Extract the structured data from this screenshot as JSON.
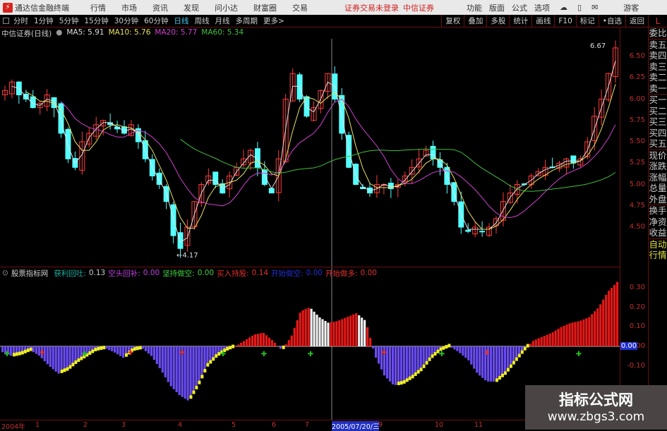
{
  "menubar": {
    "app_title": "通达信金融终端",
    "items": [
      "行情",
      "市场",
      "资讯",
      "发现",
      "问小达",
      "财富圈",
      "交易"
    ],
    "login_status": "证券交易未登录",
    "broker": "中信证券",
    "right_items": [
      "功能",
      "版面",
      "公式",
      "选项"
    ],
    "user": "游客"
  },
  "toolbar": {
    "periods": [
      "分时",
      "1分钟",
      "5分钟",
      "15分钟",
      "30分钟",
      "60分钟",
      "日线",
      "周线",
      "月线",
      "多周期",
      "更多>"
    ],
    "active": "日线",
    "right_buttons": [
      "复权",
      "叠加",
      "多股",
      "统计",
      "画线",
      "F10",
      "标记",
      "•自选",
      "返回"
    ]
  },
  "info": {
    "stock": "中信证券(日线)",
    "ma": [
      {
        "label": "MA5: 5.91",
        "color": "#dddddd"
      },
      {
        "label": "MA10: 5.76",
        "color": "#e8e060"
      },
      {
        "label": "MA20: 5.77",
        "color": "#d040d0"
      },
      {
        "label": "MA60: 5.34",
        "color": "#40c040"
      }
    ]
  },
  "price_axis": [
    "6.50",
    "6.25",
    "6.00",
    "5.75",
    "5.50",
    "5.25",
    "5.00",
    "4.75",
    "4.50"
  ],
  "annotations": {
    "high": "6.67",
    "low": "4.17"
  },
  "indicator": {
    "name": "股票指标网",
    "items": [
      {
        "label": "获利回吐:",
        "value": "0.13",
        "color": "#20b0a0"
      },
      {
        "label": "空头回补:",
        "value": "0.00",
        "color": "#c040e0"
      },
      {
        "label": "坚持做空:",
        "value": "0.00",
        "color": "#40d040"
      },
      {
        "label": "买入持股:",
        "value": "0.14",
        "color": "#e03030"
      },
      {
        "label": "开始做空:",
        "value": "0.00",
        "color": "#2030d0"
      },
      {
        "label": "开始做多:",
        "value": "0.00",
        "color": "#e03030"
      }
    ],
    "axis": [
      "0.30",
      "0.20",
      "0.10",
      "0.00",
      "-0.10"
    ],
    "current": "0.00"
  },
  "xaxis": {
    "labels": [
      "2004年",
      "1",
      "2",
      "3",
      "4",
      "5",
      "6",
      "7",
      "2005/07/20/三",
      "9",
      "10",
      "11"
    ]
  },
  "side_panel": {
    "top": "L",
    "items": [
      "委比",
      "卖五",
      "卖四",
      "卖三",
      "卖二",
      "卖一",
      "买一",
      "买二",
      "买三",
      "买四",
      "买五",
      "现价",
      "涨跌",
      "涨幅",
      "总量",
      "外盘",
      "换手",
      "净资",
      "收益",
      "自动",
      "行情"
    ]
  },
  "watermark": {
    "title": "指标公式网",
    "url": "www.zbgs3.com"
  },
  "chart_data": {
    "type": "candlestick",
    "closes": [
      6.1,
      6.2,
      6.05,
      6.0,
      5.9,
      5.95,
      6.05,
      5.9,
      5.6,
      5.3,
      5.2,
      5.5,
      5.6,
      5.7,
      5.75,
      5.7,
      5.65,
      5.6,
      5.7,
      5.5,
      5.3,
      5.1,
      5.0,
      4.8,
      4.4,
      4.25,
      4.5,
      4.8,
      5.0,
      5.1,
      5.0,
      4.9,
      5.1,
      5.2,
      5.3,
      5.4,
      5.2,
      5.0,
      4.9,
      5.3,
      6.0,
      6.3,
      6.0,
      5.8,
      5.9,
      6.1,
      6.3,
      6.0,
      5.6,
      5.2,
      5.0,
      4.95,
      4.9,
      5.0,
      5.0,
      4.95,
      5.0,
      5.1,
      5.2,
      5.3,
      5.4,
      5.3,
      5.2,
      5.0,
      4.8,
      4.5,
      4.45,
      4.5,
      4.45,
      4.5,
      4.6,
      4.8,
      4.9,
      5.0,
      5.0,
      5.1,
      5.15,
      5.2,
      5.2,
      5.25,
      5.3,
      5.25,
      5.3,
      5.5,
      5.8,
      6.0,
      6.3,
      6.6
    ],
    "ylim": [
      4.1,
      6.8
    ],
    "indicator_values": [
      -0.03,
      -0.05,
      -0.04,
      -0.02,
      -0.05,
      -0.1,
      -0.14,
      -0.12,
      -0.08,
      -0.05,
      -0.02,
      -0.01,
      -0.03,
      -0.06,
      -0.02,
      -0.01,
      -0.05,
      -0.12,
      -0.2,
      -0.25,
      -0.28,
      -0.2,
      -0.1,
      -0.05,
      -0.02,
      0.0,
      0.03,
      0.06,
      0.07,
      0.03,
      -0.02,
      0.05,
      0.18,
      0.2,
      0.15,
      0.12,
      0.13,
      0.15,
      0.17,
      0.13,
      -0.05,
      -0.15,
      -0.2,
      -0.19,
      -0.16,
      -0.12,
      -0.06,
      -0.02,
      0.0,
      -0.03,
      -0.07,
      -0.14,
      -0.18,
      -0.18,
      -0.14,
      -0.08,
      -0.02,
      0.03,
      0.05,
      0.07,
      0.1,
      0.12,
      0.13,
      0.15,
      0.2,
      0.28,
      0.33
    ],
    "indicator_ylim": [
      -0.35,
      0.35
    ]
  }
}
